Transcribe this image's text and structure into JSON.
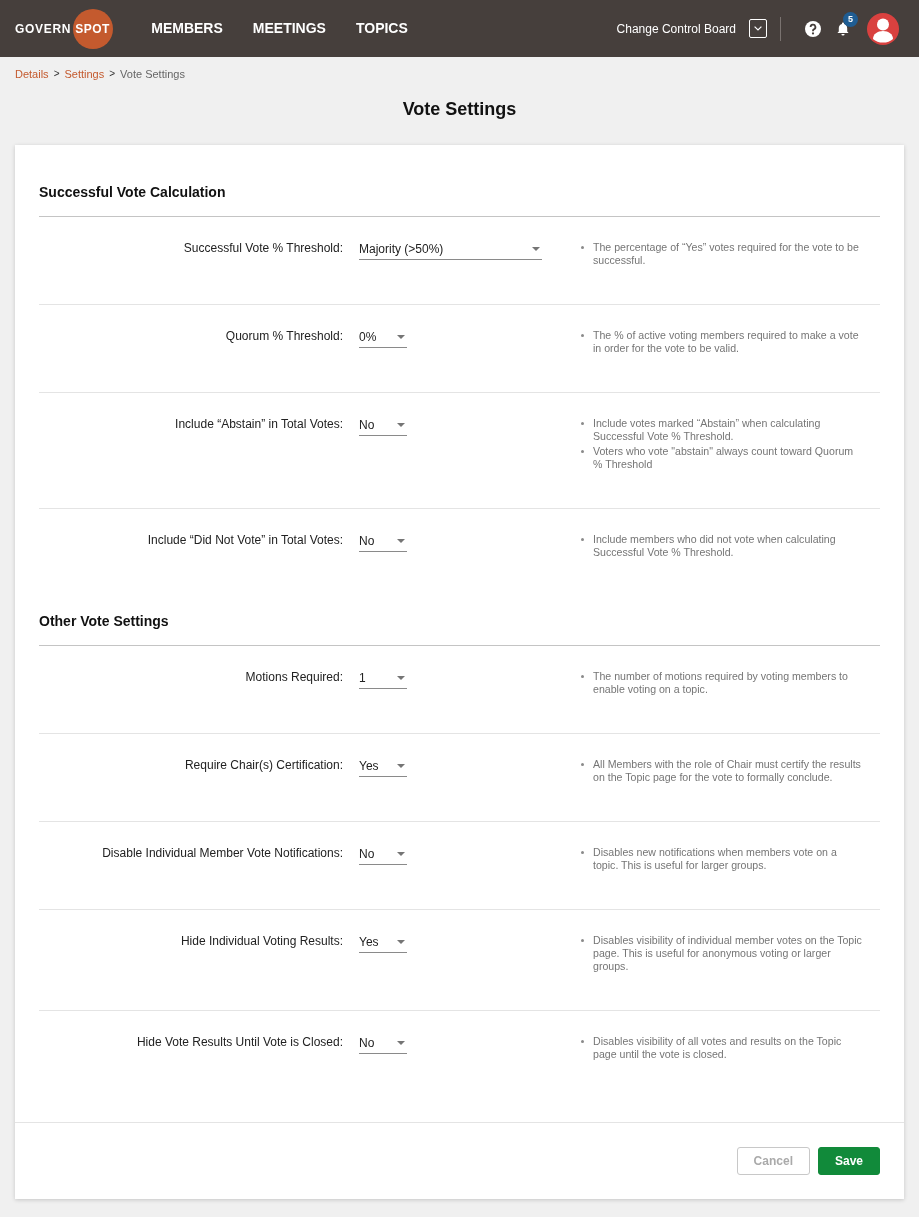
{
  "header": {
    "logo": {
      "text": "GOVERN",
      "highlight": "SPOT"
    },
    "nav": [
      {
        "label": "MEMBERS",
        "selected": false
      },
      {
        "label": "MEETINGS",
        "selected": false
      },
      {
        "label": "TOPICS",
        "selected": false
      }
    ],
    "board": {
      "name": "Change Control Board"
    },
    "notifications": {
      "count": "5"
    }
  },
  "breadcrumbs": [
    {
      "label": "Details",
      "link": true,
      "separator": ">"
    },
    {
      "label": "Settings",
      "link": true,
      "separator": ">"
    },
    {
      "label": "Vote Settings",
      "link": false
    }
  ],
  "page_title": "Vote Settings",
  "sections": [
    {
      "title": "Successful Vote Calculation",
      "settings": [
        {
          "label": "Successful Vote % Threshold:",
          "value": "Majority (>50%)",
          "notes": [
            "The percentage of “Yes” votes required for the vote to be successful."
          ]
        },
        {
          "label": "Quorum % Threshold:",
          "value": "0%",
          "notes": [
            "The % of active voting members required to make a vote in order for the vote to be valid."
          ]
        },
        {
          "label": "Include “Abstain” in Total Votes:",
          "value": "No",
          "notes": [
            "Include votes marked “Abstain” when calculating Successful Vote % Threshold.",
            "Voters who vote \"abstain\" always count toward Quorum % Threshold"
          ]
        },
        {
          "label": "Include “Did Not Vote” in Total Votes:",
          "value": "No",
          "notes": [
            "Include members who did not vote when calculating Successful Vote % Threshold."
          ]
        }
      ]
    },
    {
      "title": "Other Vote Settings",
      "settings": [
        {
          "label": "Motions Required:",
          "value": "1",
          "notes": [
            "The number of motions required by voting members to enable voting on a topic."
          ]
        },
        {
          "label": "Require Chair(s) Certification:",
          "value": "Yes",
          "notes": [
            "All Members with the role of Chair must certify the results on the Topic page for the vote to formally conclude."
          ]
        },
        {
          "label": "Disable Individual Member Vote Notifications:",
          "value": "No",
          "notes": [
            "Disables new notifications when members vote on a topic. This is useful for larger groups."
          ]
        },
        {
          "label": "Hide Individual Voting Results:",
          "value": "Yes",
          "notes": [
            "Disables visibility of individual member votes on the Topic page. This is useful for anonymous voting or larger groups."
          ]
        },
        {
          "label": "Hide Vote Results Until Vote is Closed:",
          "value": "No",
          "notes": [
            "Disables visibility of all votes and results on the Topic page until the vote is closed."
          ]
        }
      ]
    }
  ],
  "buttons": [
    {
      "label": "Cancel",
      "kind": "secondary",
      "disabled": true
    },
    {
      "label": "Save",
      "kind": "primary",
      "disabled": false
    }
  ]
}
